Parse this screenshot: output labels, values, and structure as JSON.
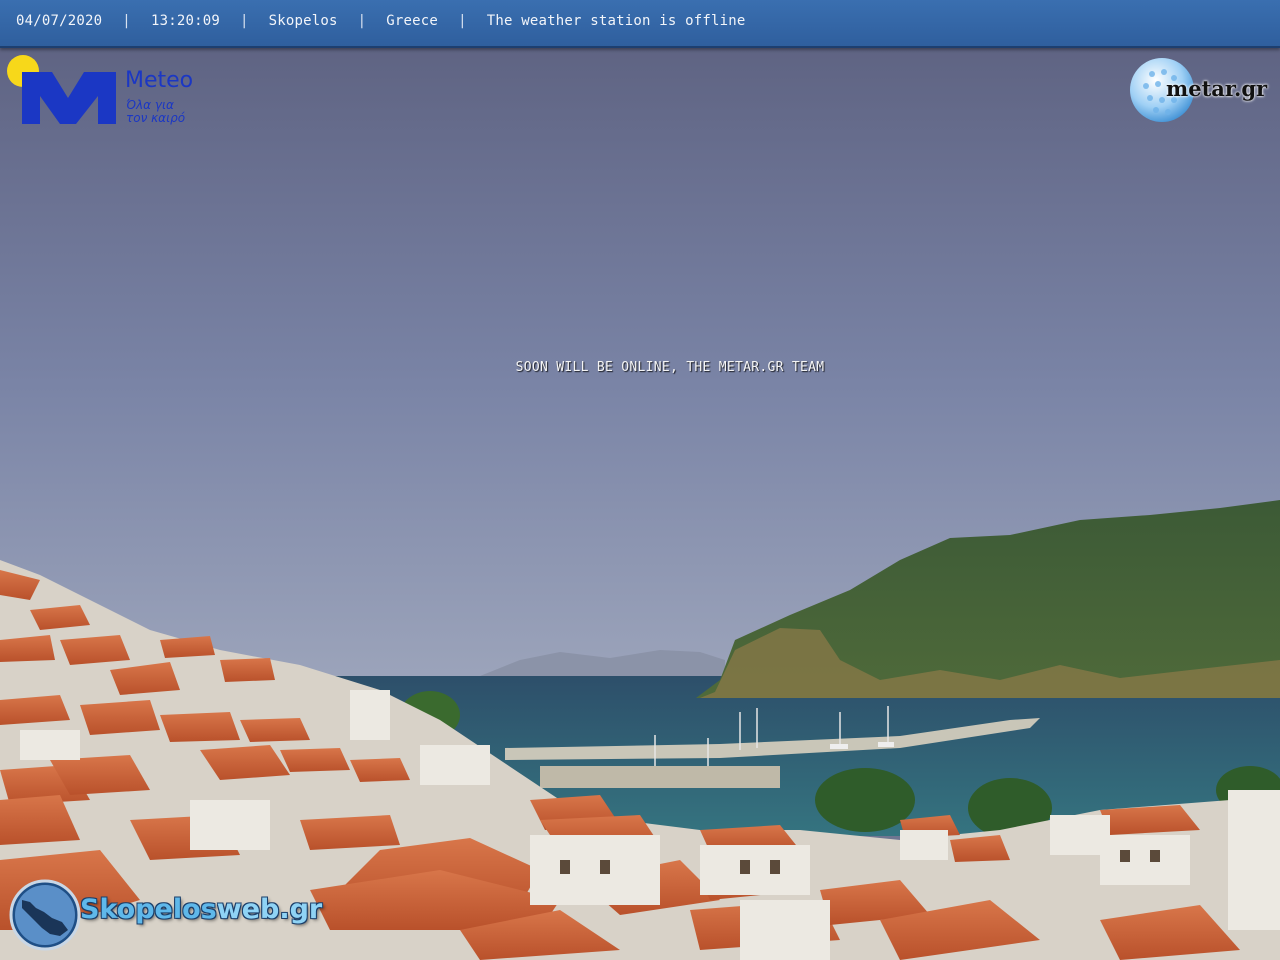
{
  "status_bar": {
    "date": "04/07/2020",
    "time": "13:20:09",
    "location": "Skopelos",
    "country": "Greece",
    "station_status": "The weather station is offline",
    "separator": "|"
  },
  "overlay_message": "SOON WILL BE ONLINE, THE METAR.GR TEAM",
  "logos": {
    "meteo": {
      "brand": "Meteo",
      "tagline_line1": "Όλα για",
      "tagline_line2": "τον καιρό",
      "icon": "meteo-m-sun-logo"
    },
    "metar": {
      "text": "metar.gr",
      "icon": "golf-ball-globe-logo"
    },
    "skopelosweb": {
      "text_main": "Skopelos",
      "text_suffix": "web.gr",
      "icon": "island-map-badge"
    }
  },
  "colors": {
    "status_bar_bg": "#3468a8",
    "meteo_blue": "#1b37c4",
    "meteo_sun": "#f7d81a",
    "sky_top": "#5d6180",
    "sky_bottom": "#8a95b4",
    "sea": "#2f6578",
    "roof": "#d0663a"
  }
}
